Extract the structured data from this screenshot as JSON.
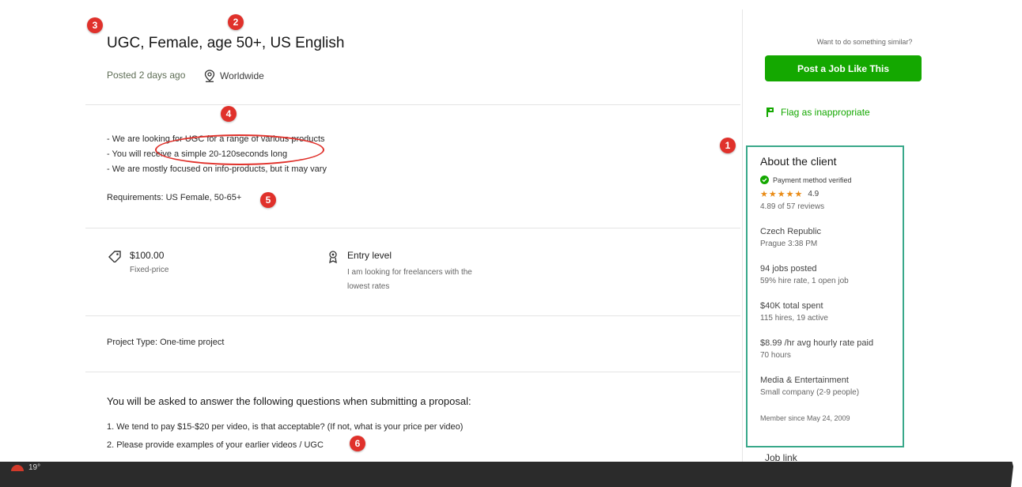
{
  "job": {
    "title": "UGC, Female, age 50+, US English",
    "posted": "Posted 2 days ago",
    "location": "Worldwide",
    "description": [
      "- We are looking for UGC for a range of various products",
      "- You will receive a simple 20-120seconds long",
      "- We are mostly focused on info-products, but it may vary"
    ],
    "requirements": "Requirements: US Female, 50-65+",
    "price": "$100.00",
    "price_type": "Fixed-price",
    "level": "Entry level",
    "level_desc": "I am looking for freelancers with the lowest rates",
    "project_type_label": "Project Type:",
    "project_type_value": "One-time project",
    "questions_title": "You will be asked to answer the following questions when submitting a proposal:",
    "questions": [
      "1. We tend to pay $15-$20 per video, is that acceptable? (If not, what is your price per video)",
      "2. Please provide examples of your earlier videos / UGC"
    ]
  },
  "sidebar": {
    "want_similar": "Want to do something similar?",
    "post_job_button": "Post a Job Like This",
    "flag": "Flag as inappropriate",
    "joblink": "Job link"
  },
  "client": {
    "heading": "About the client",
    "payment_verified": "Payment method verified",
    "stars": "★★★★★",
    "rating": "4.9",
    "reviews": "4.89 of 57 reviews",
    "country": "Czech Republic",
    "city_time": "Prague 3:38 PM",
    "jobs_posted": "94 jobs posted",
    "hire_rate": "59% hire rate, 1 open job",
    "total_spent": "$40K total spent",
    "hires": "115 hires, 19 active",
    "avg_rate": "$8.99 /hr avg hourly rate paid",
    "hours": "70 hours",
    "industry": "Media & Entertainment",
    "company_size": "Small company (2-9 people)",
    "member_since": "Member since May 24, 2009"
  },
  "annotations": [
    "1",
    "2",
    "3",
    "4",
    "5",
    "6"
  ],
  "taskbar": {
    "temp": "19°"
  },
  "colors": {
    "accent_green": "#14a800",
    "annotation_red": "#e0312b",
    "box_teal": "#39a88a",
    "star_orange": "#e98b16"
  }
}
